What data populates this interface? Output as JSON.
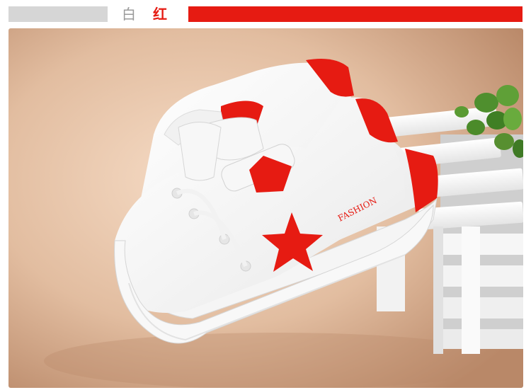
{
  "header": {
    "color_labels": [
      "白",
      "红"
    ]
  },
  "product": {
    "shoe_text": "FASHION"
  },
  "colors": {
    "accent_red": "#e61b12",
    "bar_grey": "#d6d6d6",
    "backdrop": "#d9b59a"
  }
}
